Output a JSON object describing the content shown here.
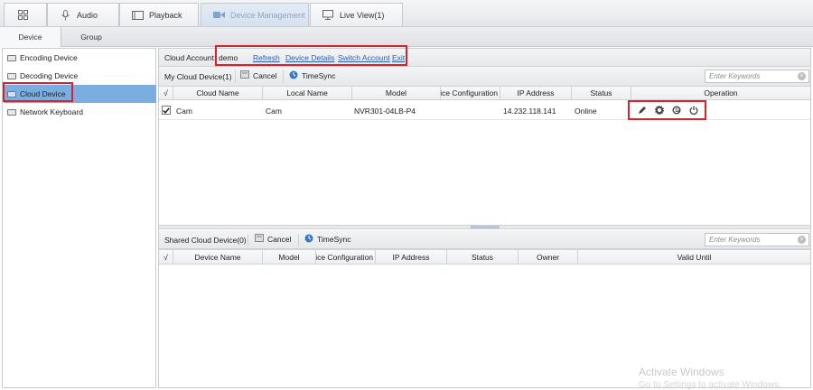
{
  "top_tabs": [
    {
      "label": "",
      "icon": "grid-icon"
    },
    {
      "label": "Audio",
      "icon": "microphone-icon"
    },
    {
      "label": "Playback",
      "icon": "playback-icon"
    },
    {
      "label": "Device Management",
      "icon": "camera-icon",
      "active": true
    },
    {
      "label": "Live View(1)",
      "icon": "monitor-icon"
    }
  ],
  "sub_tabs": [
    "Device",
    "Group"
  ],
  "sidebar": {
    "items": [
      {
        "label": "Encoding Device"
      },
      {
        "label": "Decoding Device"
      },
      {
        "label": "Cloud Device",
        "selected": true
      },
      {
        "label": "Network Keyboard"
      }
    ]
  },
  "cloud_account": {
    "label": "Cloud Account:",
    "value": "demo",
    "links": [
      "Refresh",
      "Device Details",
      "Switch Account",
      "Exit"
    ]
  },
  "my_devices": {
    "title": "My Cloud Device(1)",
    "cancel_label": "Cancel",
    "timesync_label": "TimeSync",
    "search_placeholder": "Enter Keywords",
    "columns": [
      "√",
      "Cloud Name",
      "Local Name",
      "Model",
      "Device Configuration",
      "IP Address",
      "Status",
      "Operation"
    ],
    "rows": [
      {
        "checked": true,
        "cloud_name": "Cam",
        "local_name": "Cam",
        "model": "NVR301-04LB-P4",
        "device_config": "",
        "ip": "14.232.118.141",
        "status": "Online"
      }
    ],
    "operations": [
      "edit-icon",
      "gear-icon",
      "browser-icon",
      "power-icon"
    ]
  },
  "shared_devices": {
    "title": "Shared Cloud Device(0)",
    "cancel_label": "Cancel",
    "timesync_label": "TimeSync",
    "search_placeholder": "Enter Keywords",
    "columns": [
      "√",
      "Device Name",
      "Model",
      "Device Configuration",
      "IP Address",
      "Status",
      "Owner",
      "Valid Until"
    ]
  },
  "watermark": {
    "line1": "Activate Windows",
    "line2": "Go to Settings to activate Windows."
  },
  "colors": {
    "selected": "#7aaee0",
    "highlight_box": "#d9202b",
    "link": "#2a5db0"
  }
}
